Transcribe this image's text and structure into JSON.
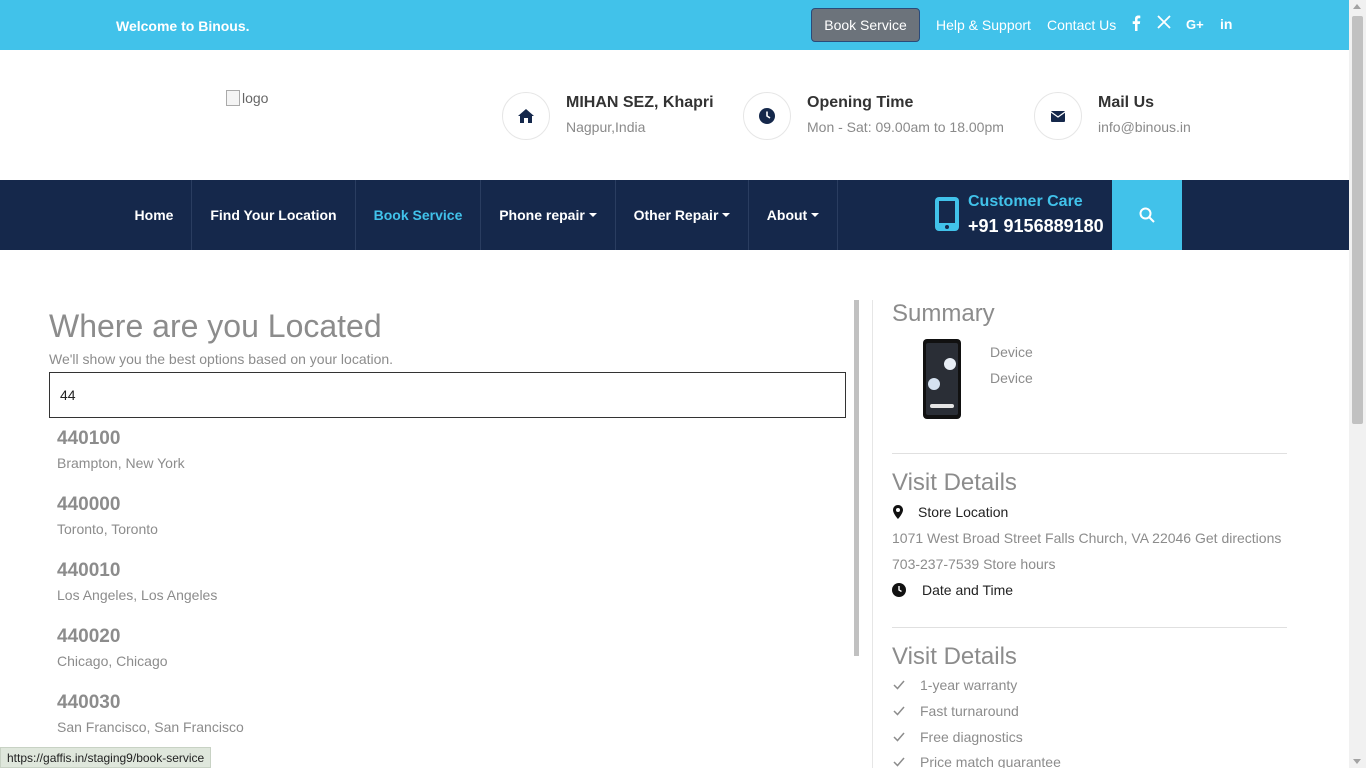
{
  "topbar": {
    "welcome": "Welcome to Binous.",
    "book_service": "Book Service",
    "help": "Help & Support",
    "contact": "Contact Us",
    "social": [
      "facebook-icon",
      "x-icon",
      "google-plus-icon",
      "linkedin-icon"
    ]
  },
  "header": {
    "logo_alt": "logo",
    "address_title": "MIHAN SEZ, Khapri",
    "address_sub": "Nagpur,India",
    "hours_title": "Opening Time",
    "hours_sub": "Mon - Sat: 09.00am to 18.00pm",
    "mail_title": "Mail Us",
    "mail_sub": "info@binous.in"
  },
  "nav": {
    "items": [
      {
        "label": "Home",
        "dropdown": false,
        "active": false
      },
      {
        "label": "Find Your Location",
        "dropdown": false,
        "active": false
      },
      {
        "label": "Book Service",
        "dropdown": false,
        "active": true
      },
      {
        "label": "Phone repair",
        "dropdown": true,
        "active": false
      },
      {
        "label": "Other Repair",
        "dropdown": true,
        "active": false
      },
      {
        "label": "About",
        "dropdown": true,
        "active": false
      }
    ],
    "customer_care_title": "Customer Care",
    "customer_care_phone": "+91 9156889180"
  },
  "location": {
    "title": "Where are you Located",
    "subtitle": "We'll show you the best options based on your location.",
    "input_value": "44",
    "results": [
      {
        "code": "440100",
        "place": "Brampton, New York"
      },
      {
        "code": "440000",
        "place": "Toronto, Toronto"
      },
      {
        "code": "440010",
        "place": "Los Angeles, Los Angeles"
      },
      {
        "code": "440020",
        "place": "Chicago, Chicago"
      },
      {
        "code": "440030",
        "place": "San Francisco, San Francisco"
      }
    ]
  },
  "summary": {
    "title": "Summary",
    "device_line1": "Device",
    "device_line2": "Device",
    "visit_title_1": "Visit Details",
    "store_location_label": "Store Location",
    "address": "1071 West Broad Street Falls Church, VA 22046 Get directions",
    "phone_hours": "703-237-7539 Store hours",
    "date_time_label": "Date and Time",
    "visit_title_2": "Visit Details",
    "features": [
      "1-year warranty",
      "Fast turnaround",
      "Free diagnostics",
      "Price match guarantee"
    ]
  },
  "status_url": "https://gaffis.in/staging9/book-service",
  "colors": {
    "accent": "#41c2ea",
    "nav_bg": "#15284b",
    "muted_text": "#8c8c8c"
  }
}
